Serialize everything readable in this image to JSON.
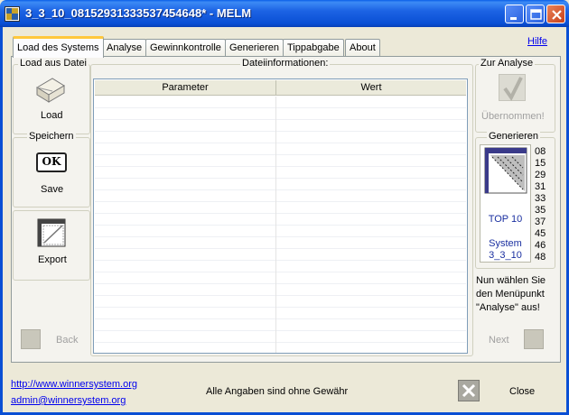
{
  "window": {
    "title": "3_3_10_08152931333537454648* - MELM"
  },
  "tabs": [
    {
      "label": "Load des Systems"
    },
    {
      "label": "Analyse"
    },
    {
      "label": "Gewinnkontrolle"
    },
    {
      "label": "Generieren"
    },
    {
      "label": "Tippabgabe"
    },
    {
      "label": "About"
    }
  ],
  "help_link": "Hilfe",
  "left_panel": {
    "load_group": "Load aus Datei",
    "load_label": "Load",
    "save_group": "Speichern",
    "save_label": "Save",
    "save_icon_text": "OK",
    "export_label": "Export",
    "back_label": "Back"
  },
  "file_info": {
    "group": "Dateiinformationen:",
    "columns": [
      "Parameter",
      "Wert"
    ]
  },
  "right_panel": {
    "zur_analyse_group": "Zur Analyse",
    "uebernommen_label": "Übernommen!",
    "generieren_group": "Generieren",
    "card_top": "TOP 10",
    "card_system": "System",
    "card_system_id": "3_3_10",
    "numbers": [
      "08",
      "15",
      "29",
      "31",
      "33",
      "35",
      "37",
      "45",
      "46",
      "48"
    ],
    "hint_lines": [
      "Nun wählen Sie",
      "den Menüpunkt",
      "\"Analyse\" aus!"
    ],
    "next_label": "Next"
  },
  "footer": {
    "website": "http://www.winnersystem.org",
    "email": "admin@winnersystem.org",
    "disclaimer": "Alle Angaben sind ohne Gewähr",
    "close_label": "Close"
  },
  "colors": {
    "title_bar": "#0a4fd4",
    "link": "#0000ee",
    "accent_tab": "#ffc83c",
    "card_text": "#1a2fa0"
  }
}
